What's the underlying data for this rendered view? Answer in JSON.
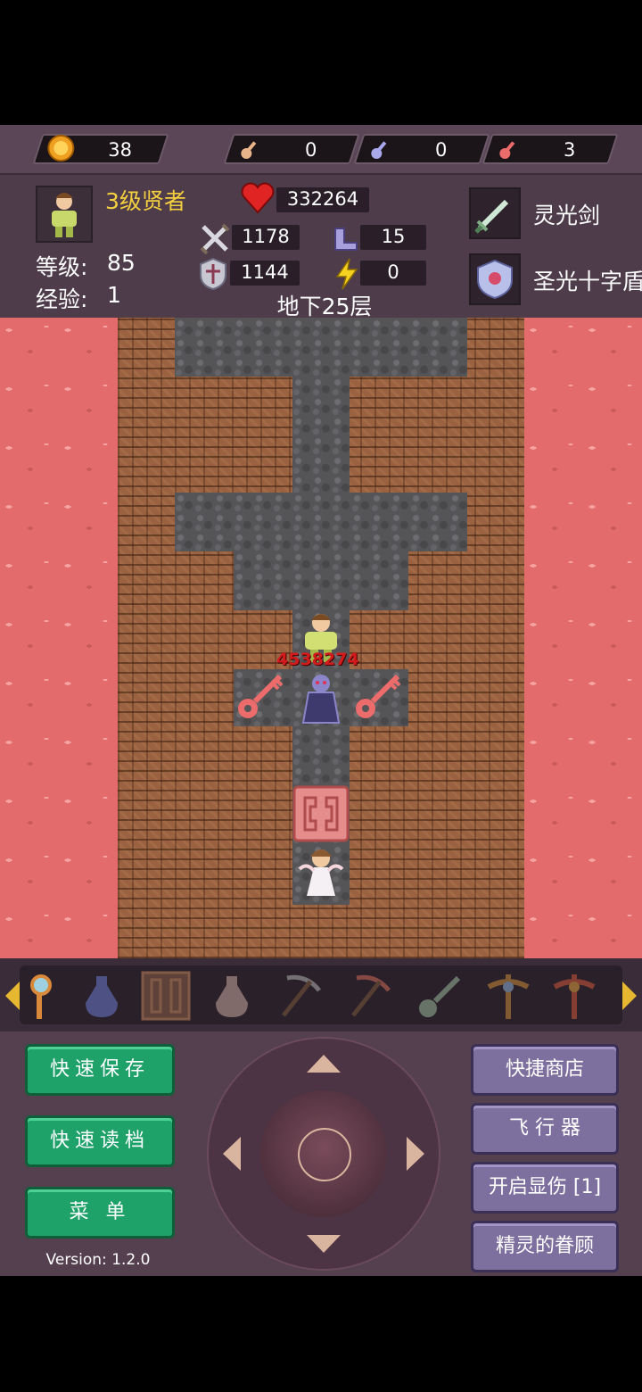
{
  "resources": [
    {
      "icon": "gold-coin-icon",
      "value": "38"
    },
    {
      "icon": "yellow-key-icon",
      "value": "0"
    },
    {
      "icon": "blue-key-icon",
      "value": "0"
    },
    {
      "icon": "red-key-icon",
      "value": "3"
    }
  ],
  "hero": {
    "title": "3级贤者",
    "level_label": "等级:",
    "level_value": "85",
    "exp_label": "经验:",
    "exp_value": "1",
    "hp": "332264",
    "attack": "1178",
    "defense": "1144",
    "magic_def": "15",
    "speed": "0"
  },
  "floor_name": "地下25层",
  "equipment": {
    "weapon": "灵光剑",
    "shield": "圣光十字盾"
  },
  "map": {
    "damage_label": "4538274"
  },
  "item_bar": {
    "items": [
      "magic-wand-icon",
      "holy-water-icon",
      "door-icon",
      "empty-flask-icon",
      "pickaxe-icon",
      "red-pickaxe-icon",
      "key-icon",
      "cross-amulet-icon",
      "cross-amulet-red-icon"
    ]
  },
  "buttons": {
    "quick_save": "快速保存",
    "quick_load": "快速读档",
    "menu": "菜 单",
    "shop": "快捷商店",
    "fly": "飞 行 器",
    "show_damage": "开启显伤 [1]",
    "fairy": "精灵的眷顾"
  },
  "version": "Version: 1.2.0",
  "colors": {
    "green_button": "#1fa26a",
    "purple_button": "#7d6f9e",
    "lava": "#e36b6b",
    "title_yellow": "#f4d03f"
  }
}
